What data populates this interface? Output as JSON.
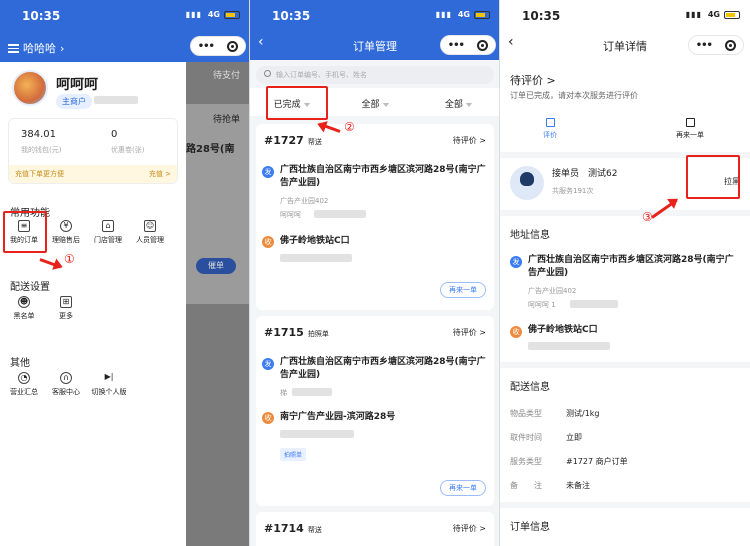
{
  "status": {
    "time": "10:35",
    "network": "4G"
  },
  "panel1": {
    "shop_name": "哈哈哈",
    "user_name": "呵呵呵",
    "user_badge": "主商户",
    "wallet_value": "384.01",
    "wallet_label": "我的钱包(元)",
    "coupon_value": "0",
    "coupon_label": "优惠卷(张)",
    "recharge_tip": "充值下单更方便",
    "recharge_link": "充值 >",
    "section_common": "常用功能",
    "common_items": [
      "我的订单",
      "理赔售后",
      "门店管理",
      "人员管理"
    ],
    "section_delivery": "配送设置",
    "delivery_items": [
      "黑名单",
      "更多"
    ],
    "section_other": "其他",
    "other_items": [
      "营业汇总",
      "客服中心",
      "切换个人版"
    ],
    "behind_tab": "待支付",
    "behind_status": "待抢单",
    "behind_addr": "路28号(南",
    "behind_btn": "催单",
    "marker": "①"
  },
  "panel2": {
    "title": "订单管理",
    "search_placeholder": "输入订单编号、手机号、姓名",
    "filters": [
      "已完成",
      "全部",
      "全部"
    ],
    "marker": "②",
    "orders": [
      {
        "no": "#1727",
        "type": "帮送",
        "status": "待评价 >",
        "from": "广西壮族自治区南宁市西乡塘区滨河路28号(南宁广告产业园)",
        "from_sub": "广告产业园402",
        "from_contact": "呵呵呵",
        "to": "佛子岭地铁站C口",
        "btn": "再来一单"
      },
      {
        "no": "#1715",
        "type": "拍照单",
        "status": "待评价 >",
        "from": "广西壮族自治区南宁市西乡塘区滨河路28号(南宁广告产业园)",
        "from_sub": "梯",
        "to": "南宁广告产业园-滨河路28号",
        "tag": "拍照单",
        "btn": "再来一单"
      },
      {
        "no": "#1714",
        "type": "帮送",
        "status": "待评价 >"
      }
    ],
    "fa": "发",
    "shou": "收"
  },
  "panel3": {
    "title": "订单详情",
    "pending_title": "待评价 >",
    "pending_desc": "订单已完成，请对本次服务进行评价",
    "actions": [
      "评价",
      "再来一单"
    ],
    "courier_label": "接单员",
    "courier_name": "测试62",
    "courier_served": "共服务191次",
    "blacklist_btn": "拉黑",
    "marker": "③",
    "addr_title": "地址信息",
    "from": "广西壮族自治区南宁市西乡塘区滨河路28号(南宁广告产业园)",
    "from_sub": "广告产业园402",
    "from_contact": "呵呵呵   1",
    "to": "佛子岭地铁站C口",
    "delivery_title": "配送信息",
    "delivery": [
      {
        "k": "物品类型",
        "v": "测试/1kg"
      },
      {
        "k": "取件时间",
        "v": "立即"
      },
      {
        "k": "服务类型",
        "v": "#1727   商户订单"
      },
      {
        "k": "备　　注",
        "v": "未备注"
      }
    ],
    "order_info_title": "订单信息"
  },
  "colors": {
    "brand": "#2f6ad8",
    "highlight": "#e8211b",
    "sender_pin": "#3a7bf6",
    "receiver_pin": "#f08a3c"
  }
}
